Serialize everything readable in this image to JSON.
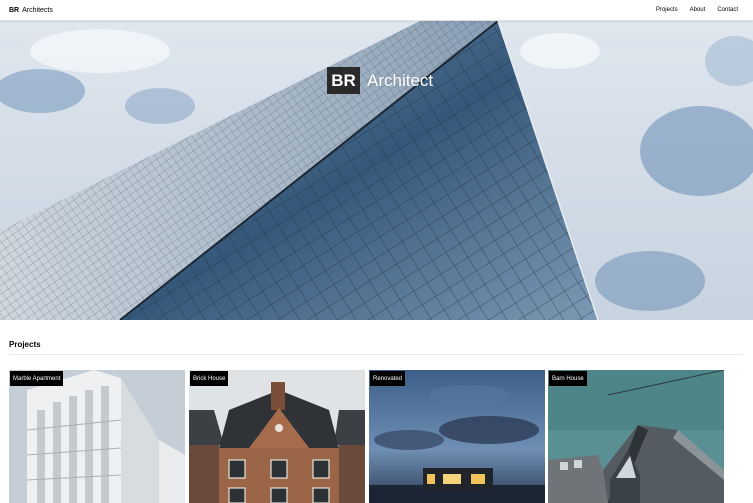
{
  "header": {
    "brand_bold": "BR",
    "brand_text": "Architects",
    "nav": [
      "Projects",
      "About",
      "Contact"
    ]
  },
  "hero": {
    "logo": "BR",
    "title": "Architect"
  },
  "projects": {
    "heading": "Projects",
    "items": [
      {
        "name": "Marble Apartment"
      },
      {
        "name": "Brick House"
      },
      {
        "name": "Renovated"
      },
      {
        "name": "Barn House"
      }
    ]
  },
  "colors": {
    "sky": "#a9c0d6",
    "glass": "#3f5f80",
    "label_bg": "#000000",
    "brick": "#8a5a40"
  }
}
